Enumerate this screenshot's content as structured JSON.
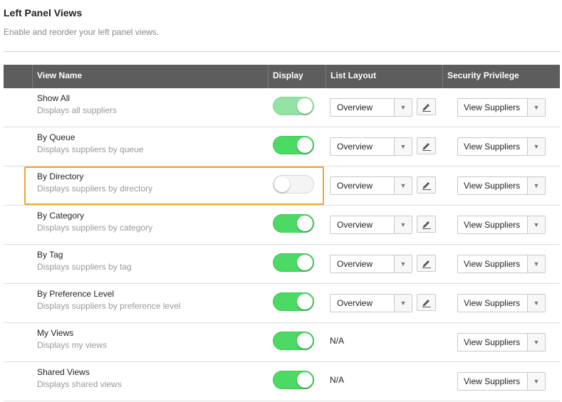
{
  "header": {
    "title": "Left Panel Views",
    "subtitle": "Enable and reorder your left panel views."
  },
  "table": {
    "columns": [
      "View Name",
      "Display",
      "List Layout",
      "Security Privilege"
    ],
    "rows": [
      {
        "name": "Show All",
        "description": "Displays all suppliers",
        "display": "on",
        "layout": "Overview",
        "privilege": "View Suppliers"
      },
      {
        "name": "By Queue",
        "description": "Displays suppliers by queue",
        "display": "on",
        "layout": "Overview",
        "privilege": "View Suppliers"
      },
      {
        "name": "By Directory",
        "description": "Displays suppliers by directory",
        "display": "off",
        "layout": "Overview",
        "privilege": "View Suppliers"
      },
      {
        "name": "By Category",
        "description": "Displays suppliers by category",
        "display": "on",
        "layout": "Overview",
        "privilege": "View Suppliers"
      },
      {
        "name": "By Tag",
        "description": "Displays suppliers by tag",
        "display": "on",
        "layout": "Overview",
        "privilege": "View Suppliers"
      },
      {
        "name": "By Preference Level",
        "description": "Displays suppliers by preference level",
        "display": "on",
        "layout": "Overview",
        "privilege": "View Suppliers"
      },
      {
        "name": "My Views",
        "description": "Displays my views",
        "display": "on",
        "layout": "N/A",
        "privilege": "View Suppliers"
      },
      {
        "name": "Shared Views",
        "description": "Displays shared views",
        "display": "on",
        "layout": "N/A",
        "privilege": "View Suppliers"
      }
    ]
  },
  "icons": {
    "edit": "pencil-icon",
    "dropdown": "caret-down-icon"
  },
  "colors": {
    "toggle_on": "#4cd964",
    "toggle_on_disabled": "#93e3a4",
    "header_bg": "#5d5d5d",
    "highlight": "#f2a531"
  }
}
